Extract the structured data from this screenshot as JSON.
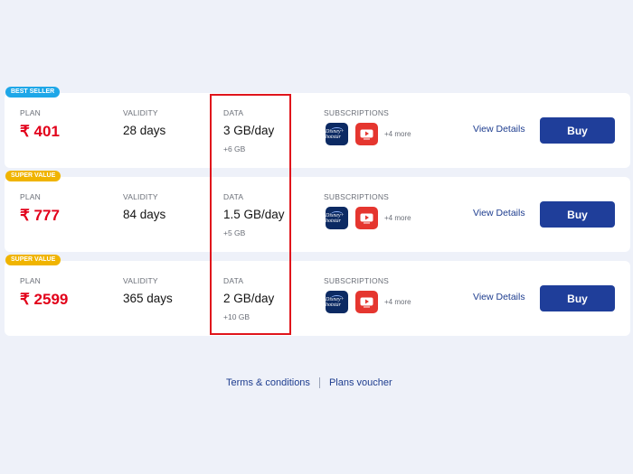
{
  "headers": {
    "plan": "PLAN",
    "validity": "VALIDITY",
    "data": "DATA",
    "subscriptions": "SUBSCRIPTIONS"
  },
  "plans": [
    {
      "badge": "BEST SELLER",
      "badge_color": "#1ea7e8",
      "price": "₹ 401",
      "validity": "28 days",
      "data": "3 GB/day",
      "extra_data": "+6 GB",
      "apps": [
        "hotstar-icon",
        "youtube-icon"
      ],
      "more": "+4 more",
      "details": "View Details",
      "buy": "Buy"
    },
    {
      "badge": "SUPER VALUE",
      "badge_color": "#f0b400",
      "price": "₹ 777",
      "validity": "84 days",
      "data": "1.5 GB/day",
      "extra_data": "+5 GB",
      "apps": [
        "hotstar-icon",
        "youtube-icon"
      ],
      "more": "+4 more",
      "details": "View Details",
      "buy": "Buy"
    },
    {
      "badge": "SUPER VALUE",
      "badge_color": "#f0b400",
      "price": "₹ 2599",
      "validity": "365 days",
      "data": "2 GB/day",
      "extra_data": "+10 GB",
      "apps": [
        "hotstar-icon",
        "youtube-icon"
      ],
      "more": "+4 more",
      "details": "View Details",
      "buy": "Buy"
    }
  ],
  "hotstar_label": "Disney+ hotstar",
  "footer": {
    "terms": "Terms & conditions",
    "voucher": "Plans voucher"
  },
  "colors": {
    "accent": "#1f3e9a",
    "price": "#e2001a",
    "highlight": "#e0151c",
    "background": "#eef1f9"
  }
}
